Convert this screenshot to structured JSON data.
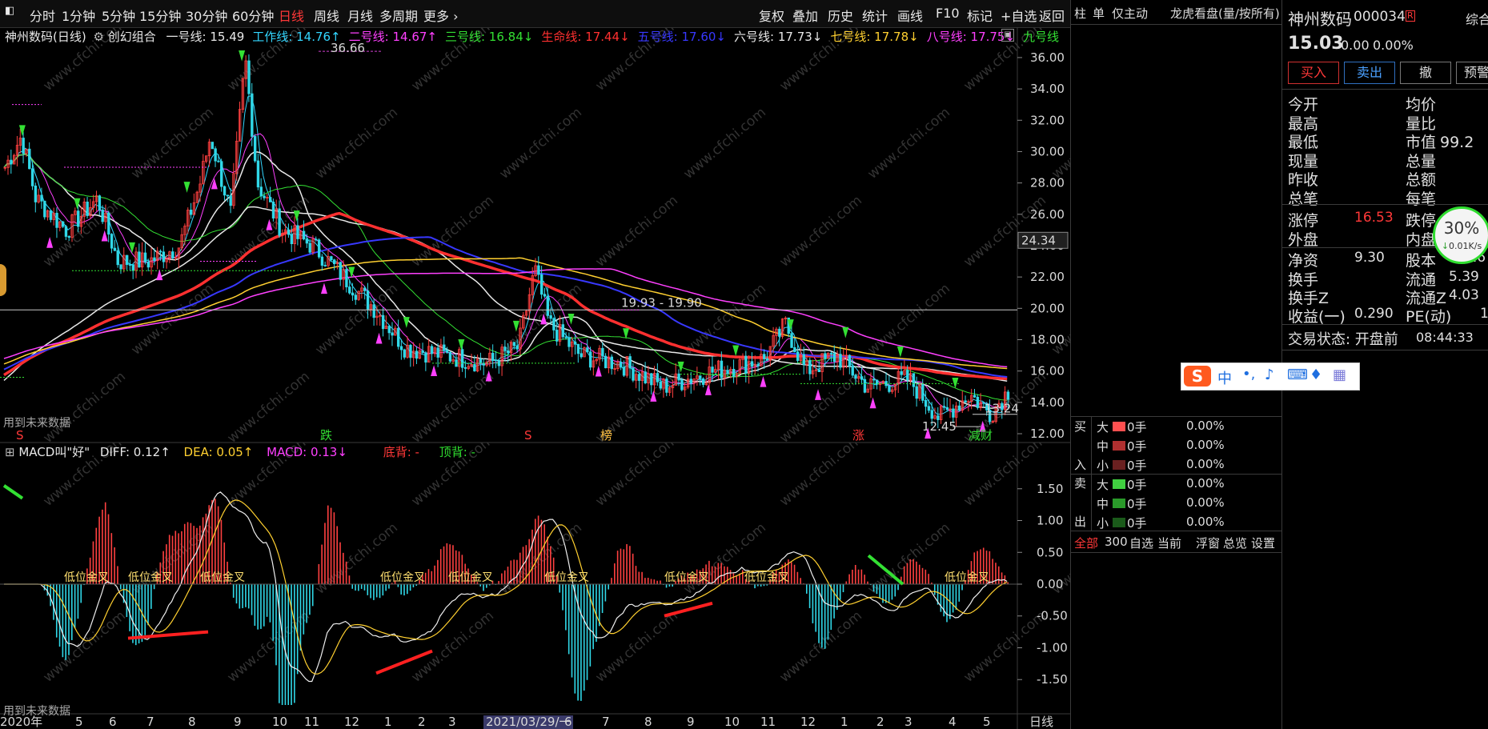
{
  "topbar": {
    "periods": [
      "分时",
      "1分钟",
      "5分钟",
      "15分钟",
      "30分钟",
      "60分钟",
      "日线",
      "周线",
      "月线",
      "多周期",
      "更多"
    ],
    "active": "日线",
    "tools": [
      "复权",
      "叠加",
      "历史",
      "统计",
      "画线",
      "F10",
      "标记",
      "+自选",
      "返回"
    ]
  },
  "main_legend": {
    "title": "神州数码(日线)",
    "indicator": "创幻组合",
    "lines": [
      {
        "label": "一号线: 15.49",
        "color": "#e8e8e8"
      },
      {
        "label": "工作线: 14.76↑",
        "color": "#33d6ff"
      },
      {
        "label": "二号线: 14.67↑",
        "color": "#ff40ff"
      },
      {
        "label": "三号线: 16.84↓",
        "color": "#33e033"
      },
      {
        "label": "生命线: 17.44↓",
        "color": "#ff3030"
      },
      {
        "label": "五号线: 17.60↓",
        "color": "#3838ff"
      },
      {
        "label": "六号线: 17.73↓",
        "color": "#e8e8e8"
      },
      {
        "label": "七号线: 17.78↓",
        "color": "#ffd030"
      },
      {
        "label": "八号线: 17.75↓",
        "color": "#ff40ff"
      },
      {
        "label": "九号线",
        "color": "#33e033"
      }
    ]
  },
  "main_chart": {
    "y_ticks": [
      "36.00",
      "34.00",
      "32.00",
      "30.00",
      "28.00",
      "26.00",
      "24.00",
      "22.00",
      "20.00",
      "18.00",
      "16.00",
      "14.00",
      "12.00"
    ],
    "y_range": [
      12,
      36.66
    ],
    "cursor_price": "24.34",
    "high_label": "36.66",
    "low_label": "12.45",
    "last_label": "13.24",
    "range_label": "19.93 - 19.90",
    "future_note": "用到未来数据",
    "markers": [
      {
        "text": "S",
        "color": "#ff3838"
      },
      {
        "text": "跌",
        "color": "#33e033"
      },
      {
        "text": "S",
        "color": "#ff3838"
      },
      {
        "text": "榜",
        "color": "#ffc040"
      },
      {
        "text": "涨",
        "color": "#ff3838"
      },
      {
        "text": "减财",
        "color": "#33e033"
      }
    ]
  },
  "macd_legend": {
    "name": "MACD叫\"好\"",
    "diff": "DIFF: 0.12↑",
    "dea": "DEA: 0.05↑",
    "macd": "MACD: 0.13↓",
    "bottom": "底背: -",
    "top": "顶背: -"
  },
  "macd_chart": {
    "y_ticks": [
      "1.50",
      "1.00",
      "0.50",
      "0.00",
      "-0.50",
      "-1.00",
      "-1.50"
    ],
    "y_range": [
      -1.95,
      1.95
    ],
    "signal_text": "低位金叉",
    "future_note": "用到未来数据"
  },
  "x_axis": {
    "labels": [
      "2020年",
      "5",
      "6",
      "7",
      "8",
      "9",
      "10",
      "11",
      "12",
      "1",
      "2",
      "3",
      "2021/03/29/一",
      "6",
      "7",
      "8",
      "9",
      "10",
      "11",
      "12",
      "1",
      "2",
      "3",
      "4",
      "5"
    ],
    "period_label": "日线"
  },
  "mid_panel": {
    "tabs": [
      "柱",
      "单",
      "仅主动",
      "龙虎看盘(量/按所有)"
    ],
    "buy_title": [
      "买",
      "入"
    ],
    "sell_title": [
      "卖",
      "出"
    ],
    "rows_buy": [
      {
        "size": "大",
        "vol": "0手",
        "pct": "0.00%",
        "color": "#ff5050"
      },
      {
        "size": "中",
        "vol": "0手",
        "pct": "0.00%",
        "color": "#b03030"
      },
      {
        "size": "小",
        "vol": "0手",
        "pct": "0.00%",
        "color": "#6a2020"
      }
    ],
    "rows_sell": [
      {
        "size": "大",
        "vol": "0手",
        "pct": "0.00%",
        "color": "#40d040"
      },
      {
        "size": "中",
        "vol": "0手",
        "pct": "0.00%",
        "color": "#2a9a2a"
      },
      {
        "size": "小",
        "vol": "0手",
        "pct": "0.00%",
        "color": "#1a5a1a"
      }
    ],
    "footer": [
      "全部",
      "300",
      "自选",
      "当前",
      "浮窗",
      "总览",
      "设置"
    ]
  },
  "quote": {
    "name": "神州数码",
    "code": "000034",
    "badge": "R",
    "corner": "综合",
    "price": "15.03",
    "change": "0.00",
    "change_pct": "0.00%",
    "buttons": [
      "买入",
      "卖出",
      "撤",
      "预警"
    ],
    "left_labels": [
      "今开",
      "最高",
      "最低",
      "现量",
      "昨收",
      "总笔"
    ],
    "right_labels": [
      "均价",
      "量比",
      "市值",
      "总量",
      "总额",
      "每笔"
    ],
    "market_cap": "99.2",
    "limit_up_label": "涨停",
    "limit_up": "16.53",
    "limit_down_label": "跌停",
    "outer": "外盘",
    "inner": "内盘",
    "net_asset_label": "净资",
    "net_asset": "9.30",
    "capital_label": "股本",
    "capital": "6.6",
    "turnover": "换手",
    "float_label": "流通",
    "float_val": "5.39",
    "turnoverz": "换手Z",
    "floatz_label": "流通Z",
    "floatz_val": "4.03",
    "eps_label": "收益(一)",
    "eps": "0.290",
    "pe_label": "PE(动)",
    "pe": "1",
    "status_label": "交易状态: 开盘前",
    "status_time": "08:44:33",
    "gauge_pct": "30%",
    "gauge_speed": "0.01K/s"
  },
  "colors": {
    "up": "#ff3838",
    "down": "#2fdc2f",
    "candle_up": "#ff4040",
    "candle_down": "#30d8e8"
  }
}
